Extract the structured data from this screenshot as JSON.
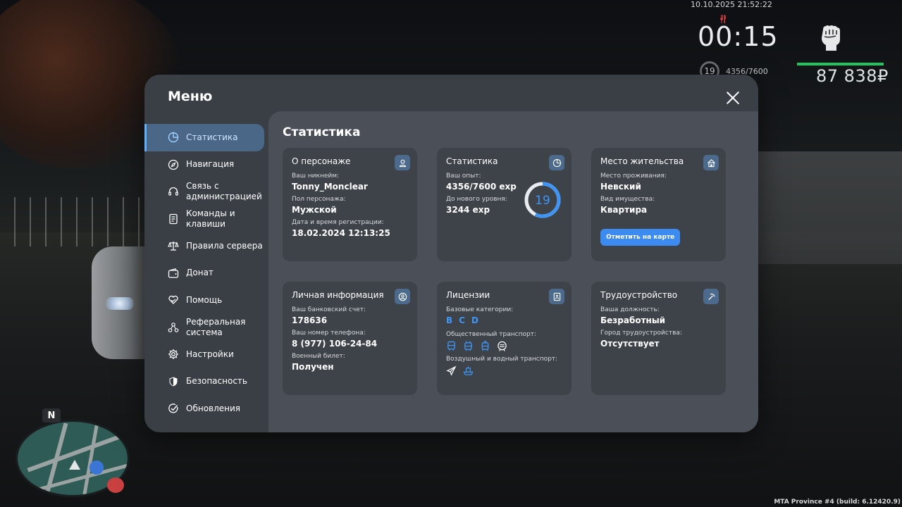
{
  "hud": {
    "datetime": "10.10.2025 21:52:22",
    "timer": "00:15",
    "level": "19",
    "exp": "4356/7600",
    "money": "87 838₽",
    "health_fraction": 1.0
  },
  "minimap": {
    "north": "N"
  },
  "build": "MTA Province #4 (build: 6.12420.9)",
  "menu": {
    "title": "Меню",
    "sidebar": [
      {
        "label": "Статистика",
        "icon": "pie-chart-icon",
        "active": true
      },
      {
        "label": "Навигация",
        "icon": "compass-icon"
      },
      {
        "label": "Связь с администрацией",
        "icon": "headset-icon"
      },
      {
        "label": "Команды и клавиши",
        "icon": "document-icon"
      },
      {
        "label": "Правила сервера",
        "icon": "scales-icon"
      },
      {
        "label": "Донат",
        "icon": "wallet-icon"
      },
      {
        "label": "Помощь",
        "icon": "heart-hands-icon"
      },
      {
        "label": "Реферальная система",
        "icon": "network-icon"
      },
      {
        "label": "Настройки",
        "icon": "gear-icon"
      },
      {
        "label": "Безопасность",
        "icon": "shield-icon"
      },
      {
        "label": "Обновления",
        "icon": "check-circle-icon"
      }
    ]
  },
  "content": {
    "title": "Статистика",
    "character": {
      "title": "О персонаже",
      "nickname_label": "Ваш никнейм:",
      "nickname": "Tonny_Monclear",
      "gender_label": "Пол персонажа:",
      "gender": "Мужской",
      "reg_label": "Дата и время регистрации:",
      "reg": "18.02.2024 12:13:25"
    },
    "stats": {
      "title": "Статистика",
      "exp_label": "Ваш опыт:",
      "exp": "4356/7600 exp",
      "next_label": "До нового уровня:",
      "next": "3244 exp",
      "level": "19",
      "progress": 0.573
    },
    "residence": {
      "title": "Место жительства",
      "place_label": "Место проживания:",
      "place": "Невский",
      "type_label": "Вид имущества:",
      "type": "Квартира",
      "button": "Отметить на карте"
    },
    "personal": {
      "title": "Личная информация",
      "bank_label": "Ваш банковский счет:",
      "bank": "178636",
      "phone_label": "Ваш номер телефона:",
      "phone": "8 (977) 106-24-84",
      "military_label": "Военный билет:",
      "military": "Получен"
    },
    "licenses": {
      "title": "Лицензии",
      "basic_label": "Базовые категории:",
      "basic": [
        "B",
        "C",
        "D"
      ],
      "public_label": "Общественный транспорт:",
      "public_icons": [
        "bus-icon",
        "trolleybus-icon",
        "tram-icon",
        "metro-icon"
      ],
      "air_label": "Воздушный и водный транспорт:",
      "air_icons": [
        "plane-icon",
        "boat-icon"
      ]
    },
    "employment": {
      "title": "Трудоустройство",
      "position_label": "Ваша должность:",
      "position": "Безработный",
      "city_label": "Город трудоустройства:",
      "city": "Отсутствует"
    }
  },
  "colors": {
    "accent": "#3f95f5",
    "active_bg": "#4a6788",
    "health": "#1ec55f"
  }
}
